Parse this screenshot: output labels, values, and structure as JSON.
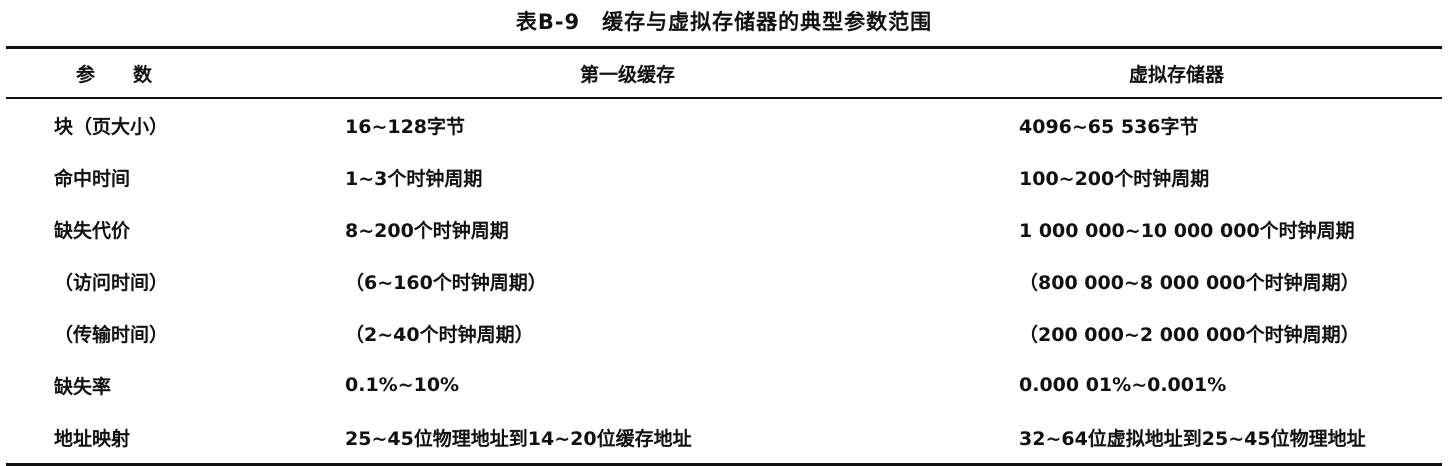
{
  "title": "表B-9　缓存与虚拟存储器的典型参数范围",
  "headers": [
    "参　　数",
    "第一级缓存",
    "虚拟存储器"
  ],
  "rows": [
    [
      "块（页大小）",
      "16~128字节",
      "4096~65 536字节"
    ],
    [
      "命中时间",
      "1~3个时钟周期",
      "100~200个时钟周期"
    ],
    [
      "缺失代价",
      "8~200个时钟周期",
      "1 000 000~10 000 000个时钟周期"
    ],
    [
      "（访问时间）",
      "（6~160个时钟周期）",
      "（800 000~8 000 000个时钟周期）"
    ],
    [
      "（传输时间）",
      "（2~40个时钟周期）",
      "（200 000~2 000 000个时钟周期）"
    ],
    [
      "缺失率",
      "0.1%~10%",
      "0.000 01%~0.001%"
    ],
    [
      "地址映射",
      "25~45位物理地址到14~20位缓存地址",
      "32~64位虚拟地址到25~45位物理地址"
    ]
  ]
}
